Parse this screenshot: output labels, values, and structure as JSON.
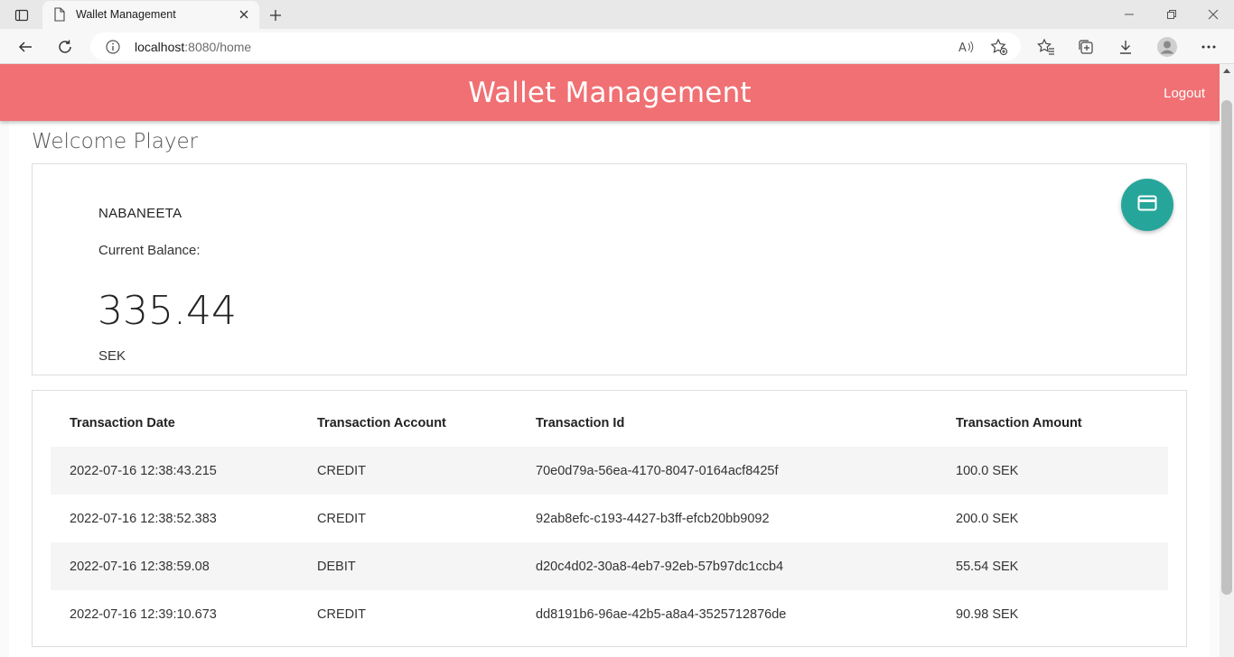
{
  "browser": {
    "tab_title": "Wallet Management",
    "url_host": "localhost",
    "url_rest": ":8080/home"
  },
  "header": {
    "title": "Wallet Management",
    "logout_label": "Logout",
    "color": "#f07073"
  },
  "welcome": "Welcome Player",
  "account": {
    "name": "NABANEETA",
    "balance_label": "Current Balance:",
    "balance": "335.44",
    "currency": "SEK",
    "fab_icon": "credit-card-icon",
    "fab_color": "#26a69a"
  },
  "transactions": {
    "headers": [
      "Transaction Date",
      "Transaction Account",
      "Transaction Id",
      "Transaction Amount"
    ],
    "rows": [
      [
        "2022-07-16 12:38:43.215",
        "CREDIT",
        "70e0d79a-56ea-4170-8047-0164acf8425f",
        "100.0 SEK"
      ],
      [
        "2022-07-16 12:38:52.383",
        "CREDIT",
        "92ab8efc-c193-4427-b3ff-efcb20bb9092",
        "200.0 SEK"
      ],
      [
        "2022-07-16 12:38:59.08",
        "DEBIT",
        "d20c4d02-30a8-4eb7-92eb-57b97dc1ccb4",
        "55.54 SEK"
      ],
      [
        "2022-07-16 12:39:10.673",
        "CREDIT",
        "dd8191b6-96ae-42b5-a8a4-3525712876de",
        "90.98 SEK"
      ]
    ]
  }
}
